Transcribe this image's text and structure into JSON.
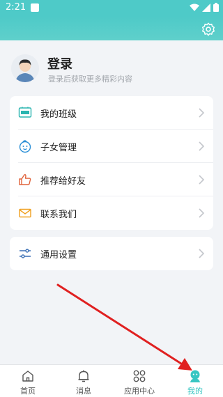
{
  "status": {
    "time": "2:21"
  },
  "profile": {
    "title": "登录",
    "subtitle": "登录后获取更多精彩内容"
  },
  "menu": [
    {
      "label": "我的班级",
      "icon": "class-icon"
    },
    {
      "label": "子女管理",
      "icon": "child-face-icon"
    },
    {
      "label": "推荐给好友",
      "icon": "thumbs-up-icon"
    },
    {
      "label": "联系我们",
      "icon": "mail-icon"
    }
  ],
  "settings": {
    "label": "通用设置",
    "icon": "sliders-icon"
  },
  "nav": [
    {
      "label": "首页",
      "icon": "home-icon"
    },
    {
      "label": "消息",
      "icon": "bell-icon"
    },
    {
      "label": "应用中心",
      "icon": "grid-icon"
    },
    {
      "label": "我的",
      "icon": "profile-icon",
      "active": true
    }
  ],
  "colors": {
    "accent": "#4ecac8",
    "annotation_arrow": "#e02020"
  }
}
